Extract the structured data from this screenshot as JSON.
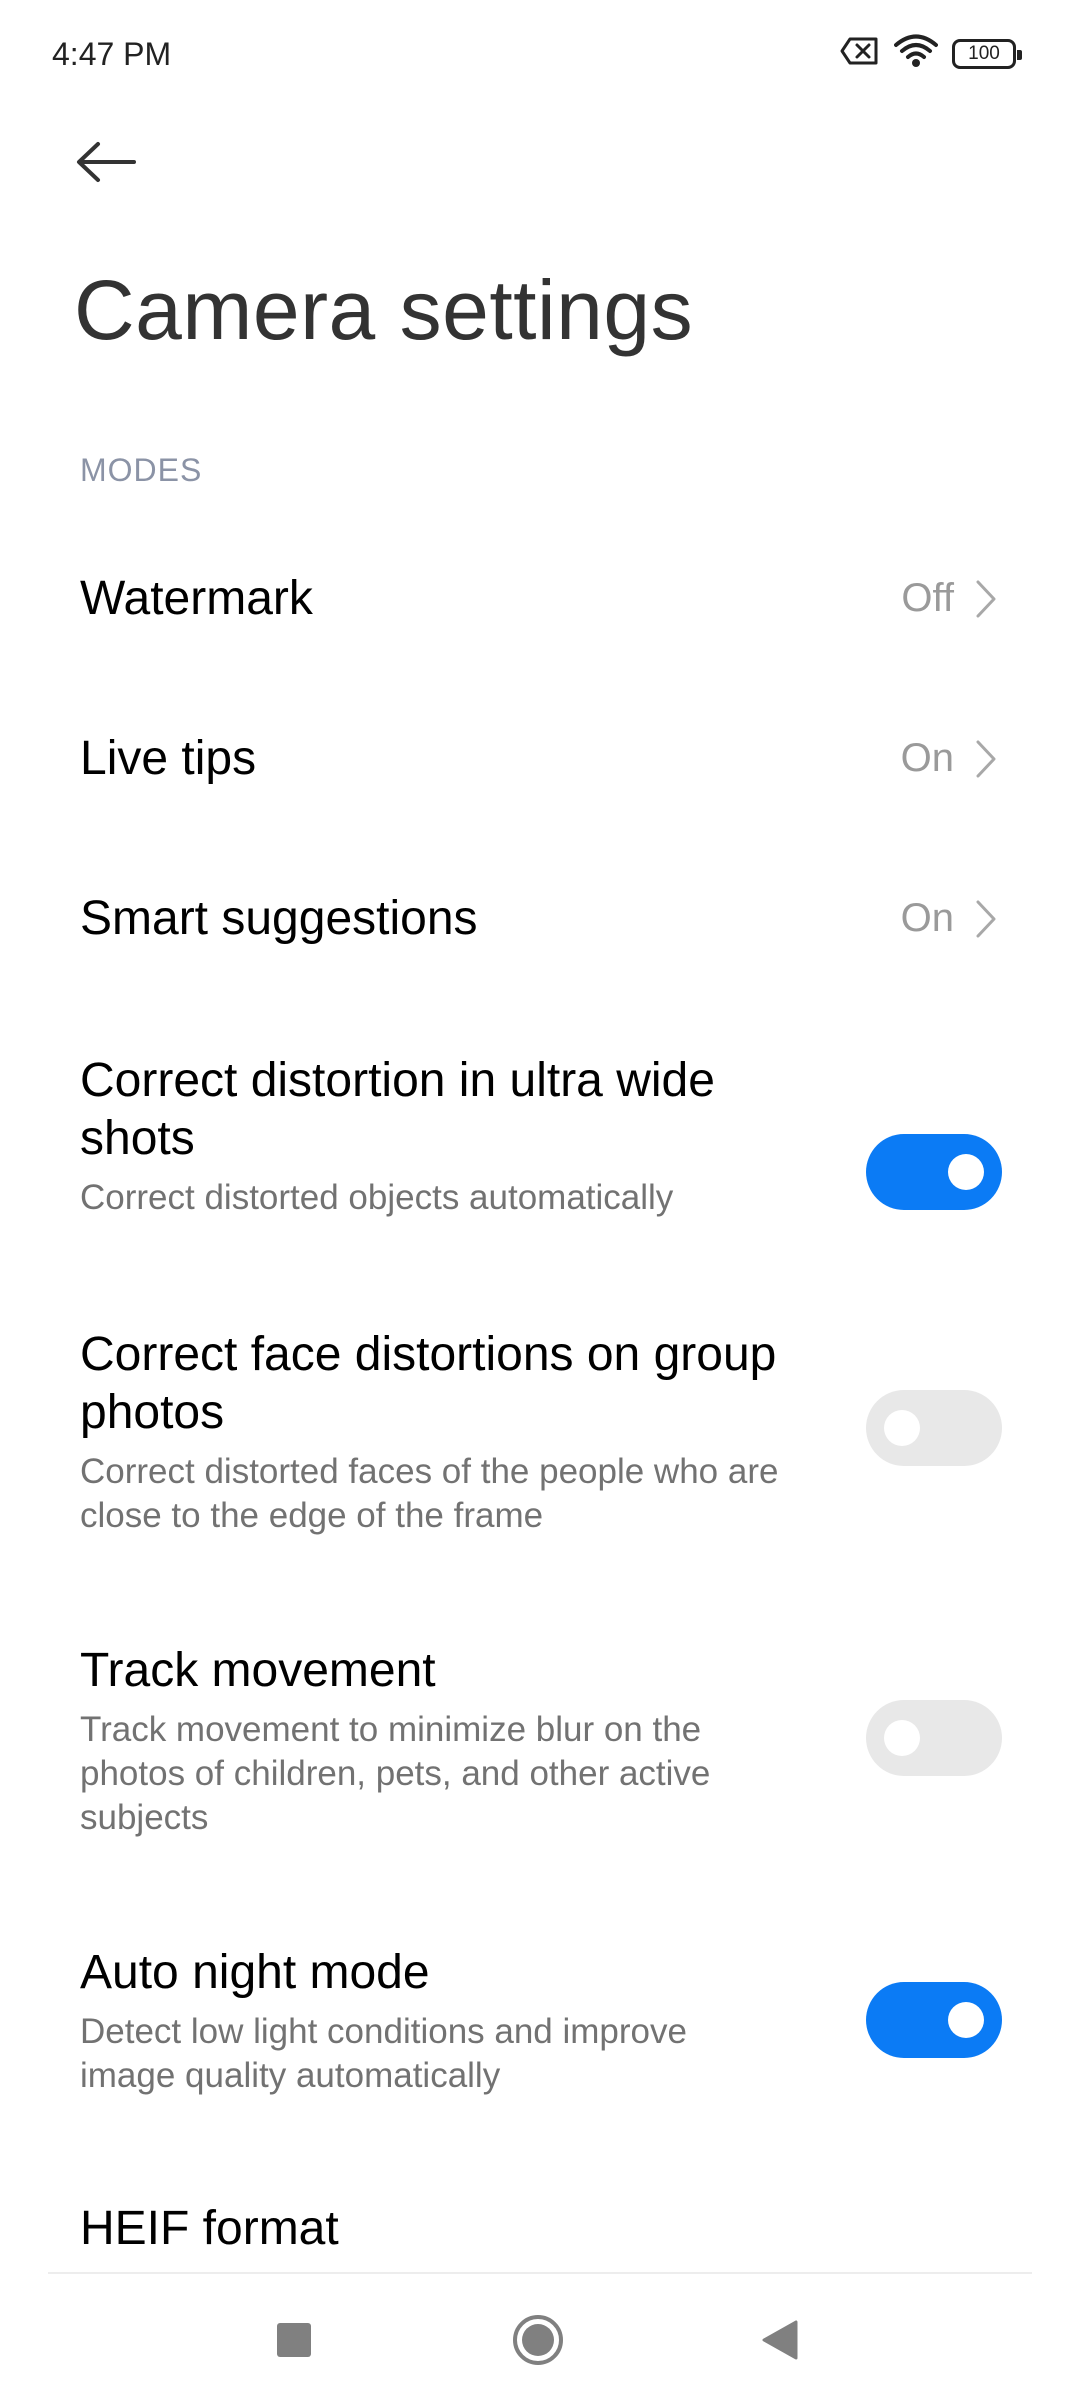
{
  "status_bar": {
    "time": "4:47 PM",
    "battery": "100",
    "icons": [
      "sim-off-icon",
      "wifi-icon",
      "battery-icon"
    ]
  },
  "header": {
    "back_icon": "arrow-left-icon",
    "title": "Camera settings"
  },
  "sections": {
    "modes_label": "MODES"
  },
  "rows": [
    {
      "title": "Watermark",
      "value": "Off",
      "type": "link"
    },
    {
      "title": "Live tips",
      "value": "On",
      "type": "link"
    },
    {
      "title": "Smart suggestions",
      "value": "On",
      "type": "link"
    },
    {
      "title_line1": "Correct distortion in ultra wide",
      "title_line2": "shots",
      "subtitle_line1": "Correct distorted objects automatically",
      "type": "toggle",
      "state": "on"
    },
    {
      "title_line1": "Correct face distortions on group",
      "title_line2": "photos",
      "subtitle_line1": "Correct distorted faces of the people who are",
      "subtitle_line2": "close to the edge of the frame",
      "type": "toggle",
      "state": "off"
    },
    {
      "title": "Track movement",
      "subtitle_line1": "Track movement to minimize blur on the",
      "subtitle_line2": "photos of children, pets, and other active",
      "subtitle_line3": "subjects",
      "type": "toggle",
      "state": "off"
    },
    {
      "title": "Auto night mode",
      "subtitle_line1": "Detect low light conditions and improve",
      "subtitle_line2": "image quality automatically",
      "type": "toggle",
      "state": "on"
    },
    {
      "title": "HEIF format",
      "type": "partial"
    }
  ],
  "nav_bar": {
    "icons": [
      "recents-square-icon",
      "home-circle-icon",
      "back-triangle-icon"
    ]
  },
  "colors": {
    "accent": "#0b7bf5",
    "toggle_off": "#e8e8e8",
    "section_header": "#8b93a6",
    "secondary_text": "#727272",
    "value_text": "#9a9a9a"
  }
}
